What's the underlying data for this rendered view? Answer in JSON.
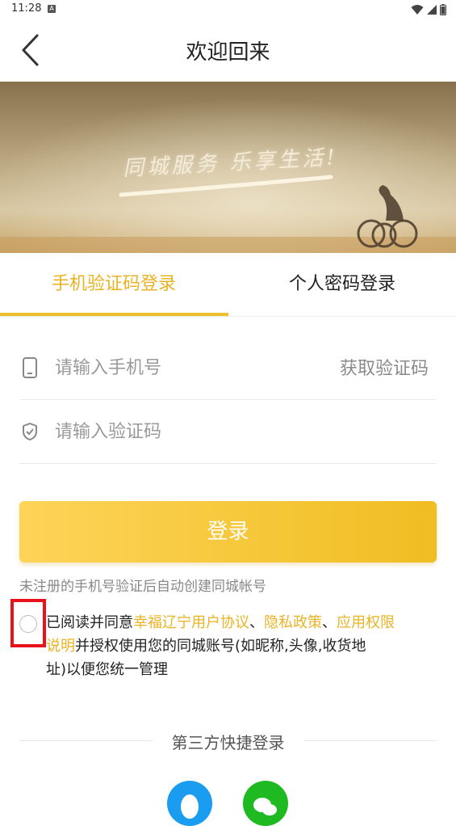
{
  "status_bar": {
    "time": "11:28",
    "notification_icon": "a-notification-icon",
    "icons": [
      "wifi-icon",
      "signal-icon",
      "battery-icon"
    ]
  },
  "header": {
    "back_icon": "chevron-left-icon",
    "title": "欢迎回来"
  },
  "banner": {
    "slogan": "同城服务 乐享生活!"
  },
  "tabs": [
    {
      "label": "手机验证码登录",
      "active": true
    },
    {
      "label": "个人密码登录",
      "active": false
    }
  ],
  "form": {
    "phone_placeholder": "请输入手机号",
    "phone_value": "",
    "get_code_label": "获取验证码",
    "code_placeholder": "请输入验证码",
    "code_value": ""
  },
  "login_button": "登录",
  "hint": "未注册的手机号验证后自动创建同城帐号",
  "agreement": {
    "checked": false,
    "prefix": "已阅读并同意",
    "link1": "幸福辽宁用户协议",
    "sep1": "、",
    "link2": "隐私政策",
    "sep2": "、",
    "link3a": "应用权限",
    "link3b": "说明",
    "suffix_line2": "并授权使用您的同城账号(如昵称,头像,收货地",
    "line3": "址)以便您统一管理"
  },
  "third_party": {
    "title": "第三方快捷登录",
    "options": [
      "qq-icon",
      "wechat-icon"
    ]
  },
  "colors": {
    "accent": "#e9b323",
    "button_gradient_start": "#fdd458",
    "button_gradient_end": "#f0bd22",
    "highlight_box": "#e8121a",
    "qq": "#1a9df0",
    "wechat": "#1fb922"
  }
}
